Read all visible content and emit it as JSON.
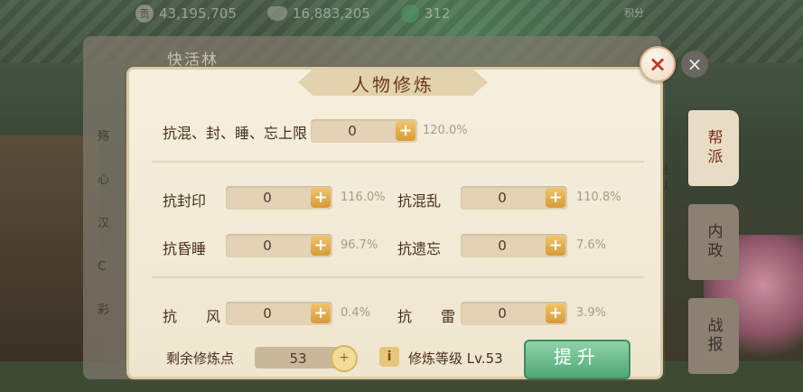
{
  "topbar": {
    "silver": "43,195,705",
    "ingots": "16,883,205",
    "jade": "312",
    "coin_glyph": "贡",
    "right_btn": "积分"
  },
  "under": {
    "title": "快活林",
    "list": [
      "殇",
      "心",
      "汉",
      "C",
      "彩"
    ],
    "note": "是以",
    "close": "×"
  },
  "side_tabs": [
    "帮派",
    "内政",
    "战报"
  ],
  "dialog": {
    "title": "人物修炼",
    "close": "×",
    "rows": [
      {
        "label": "抗混、封、睡、忘上限",
        "value": "0",
        "pct": "120.0%"
      }
    ],
    "pairs": [
      {
        "label": "抗封印",
        "value": "0",
        "pct": "116.0%"
      },
      {
        "label": "抗混乱",
        "value": "0",
        "pct": "110.8%"
      },
      {
        "label": "抗昏睡",
        "value": "0",
        "pct": "96.7%"
      },
      {
        "label": "抗遗忘",
        "value": "0",
        "pct": "7.6%"
      },
      {
        "label": "抗　　风",
        "value": "0",
        "pct": "0.4%"
      },
      {
        "label": "抗　　雷",
        "value": "0",
        "pct": "3.9%"
      }
    ],
    "plus": "+",
    "remaining_label": "剩余修炼点",
    "remaining_value": "53",
    "info": "i",
    "level_label": "修炼等级 Lv.53",
    "upgrade": "提升"
  },
  "colors": {
    "accent": "#d79a36",
    "title": "#6b3a1c",
    "upgrade": "#4fa777"
  }
}
